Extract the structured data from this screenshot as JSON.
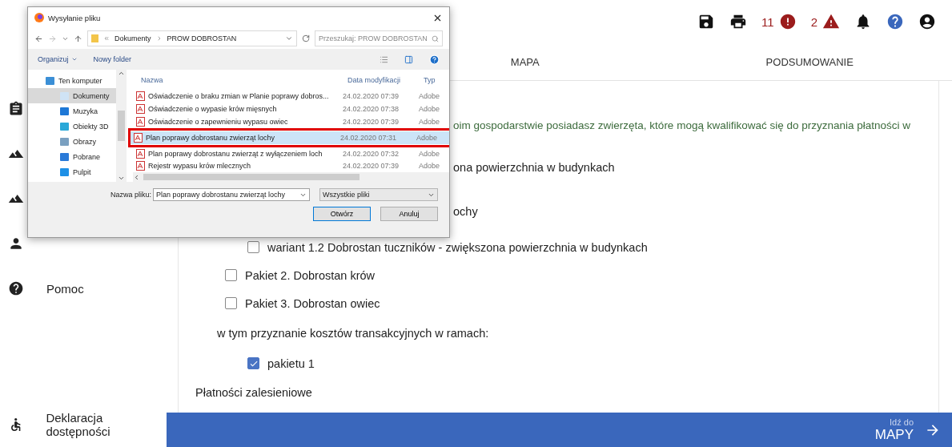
{
  "header": {
    "actions": [
      {
        "kind": "save"
      },
      {
        "kind": "print"
      },
      {
        "kind": "errors",
        "count": "11"
      },
      {
        "kind": "warnings",
        "count": "2"
      },
      {
        "kind": "bell"
      },
      {
        "kind": "help"
      },
      {
        "kind": "account"
      }
    ]
  },
  "tabs": [
    {
      "label": "MAPA"
    },
    {
      "label": "PODSUMOWANIE"
    }
  ],
  "sidebar": {
    "items": [
      {
        "kind": "clipboard"
      },
      {
        "kind": "terrain"
      },
      {
        "kind": "terrain"
      },
      {
        "kind": "person"
      },
      {
        "kind": "help",
        "label": "Pomoc"
      }
    ],
    "footer": {
      "kind": "accessibility",
      "label": "Deklaracja dostępności"
    }
  },
  "content": {
    "items": [
      {
        "kind": "note",
        "text": "oim gospodarstwie posiadasz zwierzęta, które mogą kwalifikować się do przyznania płatności w"
      },
      {
        "kind": "fragment",
        "text": "ona powierzchnia w budynkach"
      },
      {
        "kind": "fragment",
        "text": "ochy"
      },
      {
        "kind": "subcheckbox",
        "text": "wariant 1.2 Dobrostan tuczników - zwiększona powierzchnia w budynkach",
        "checked": false
      },
      {
        "kind": "checkbox",
        "text": "Pakiet 2. Dobrostan krów",
        "checked": false
      },
      {
        "kind": "checkbox",
        "text": "Pakiet 3. Dobrostan owiec",
        "checked": false
      },
      {
        "kind": "text",
        "text": "w tym przyznanie kosztów transakcyjnych w ramach:"
      },
      {
        "kind": "subcheckbox",
        "text": "pakietu 1",
        "checked": true
      },
      {
        "kind": "heading",
        "text": "Płatności zalesieniowe"
      }
    ]
  },
  "footer_nav": {
    "hint": "Idź do",
    "target": "MAPY"
  },
  "dialog": {
    "title": "Wysyłanie pliku",
    "path": [
      "Dokumenty",
      "PROW DOBROSTAN"
    ],
    "search": {
      "placeholder": "Przeszukaj: PROW DOBROSTAN"
    },
    "toolbar": [
      {
        "label": "Organizuj",
        "kind": "menu"
      },
      {
        "label": "Nowy folder",
        "kind": "button"
      }
    ],
    "nav": [
      {
        "label": "Ten komputer",
        "kind": "computer",
        "selected": false
      },
      {
        "label": "Dokumenty",
        "kind": "documents",
        "selected": true
      },
      {
        "label": "Muzyka",
        "kind": "music",
        "selected": false
      },
      {
        "label": "Obiekty 3D",
        "kind": "objects",
        "selected": false
      },
      {
        "label": "Obrazy",
        "kind": "pictures",
        "selected": false
      },
      {
        "label": "Pobrane",
        "kind": "downloads",
        "selected": false
      },
      {
        "label": "Pulpit",
        "kind": "desktop",
        "selected": false
      }
    ],
    "columns": [
      "Nazwa",
      "Data modyfikacji",
      "Typ"
    ],
    "files": [
      {
        "name": "Oświadczenie o braku zmian w Planie poprawy dobros...",
        "date": "24.02.2020 07:39",
        "type": "Adobe",
        "selected": false
      },
      {
        "name": "Oświadczenie o wypasie krów mięsnych",
        "date": "24.02.2020 07:38",
        "type": "Adobe",
        "selected": false
      },
      {
        "name": "Oświadczenie o zapewnieniu wypasu owiec",
        "date": "24.02.2020 07:39",
        "type": "Adobe",
        "selected": false
      },
      {
        "name": "Plan poprawy dobrostanu zwierząt lochy",
        "date": "24.02.2020 07:31",
        "type": "Adobe",
        "selected": true
      },
      {
        "name": "Plan poprawy dobrostanu zwierząt z wyłączeniem loch",
        "date": "24.02.2020 07:32",
        "type": "Adobe",
        "selected": false
      },
      {
        "name": "Rejestr wypasu krów mlecznych",
        "date": "24.02.2020 07:39",
        "type": "Adobe",
        "selected": false
      }
    ],
    "filename_label": "Nazwa pliku:",
    "filename": "Plan poprawy dobrostanu zwierząt lochy",
    "filter": "Wszystkie pliki",
    "buttons": [
      "Otwórz",
      "Anuluj"
    ]
  }
}
